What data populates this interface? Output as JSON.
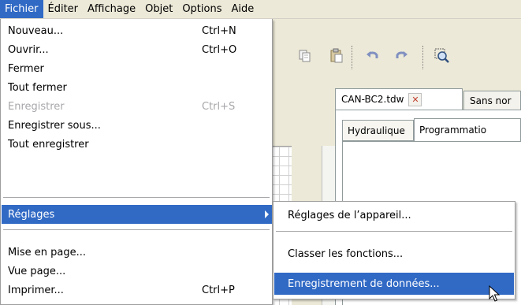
{
  "menubar": {
    "items": [
      {
        "label": "Fichier",
        "active": true
      },
      {
        "label": "Éditer"
      },
      {
        "label": "Affichage"
      },
      {
        "label": "Objet"
      },
      {
        "label": "Options"
      },
      {
        "label": "Aide"
      }
    ]
  },
  "file_menu": {
    "items": [
      {
        "label": "Nouveau...",
        "shortcut": "Ctrl+N"
      },
      {
        "label": "Ouvrir...",
        "shortcut": "Ctrl+O"
      },
      {
        "label": "Fermer",
        "shortcut": ""
      },
      {
        "label": "Tout fermer",
        "shortcut": ""
      },
      {
        "label": "Enregistrer",
        "shortcut": "Ctrl+S",
        "disabled": true
      },
      {
        "label": "Enregistrer sous...",
        "shortcut": ""
      },
      {
        "label": "Tout enregistrer",
        "shortcut": ""
      },
      {
        "label": "Réglages",
        "shortcut": "",
        "submenu": true,
        "highlighted": true
      },
      {
        "label": "Mise en page...",
        "shortcut": ""
      },
      {
        "label": "Vue page...",
        "shortcut": ""
      },
      {
        "label": "Imprimer...",
        "shortcut": "Ctrl+P"
      }
    ]
  },
  "settings_submenu": {
    "items": [
      {
        "label": "Réglages de l’appareil..."
      },
      {
        "label": "Classer les fonctions..."
      },
      {
        "label": "Enregistrement de données...",
        "highlighted": true
      }
    ]
  },
  "document_tabs": [
    {
      "label": "CAN-BC2.tdw",
      "close_icon": "close-icon"
    },
    {
      "label": "Sans nor"
    }
  ],
  "sub_tabs": [
    {
      "label": "Hydraulique"
    },
    {
      "label": "Programmatio"
    }
  ],
  "colors": {
    "highlight": "#316ac5",
    "menubar_bg": "#ece9d8",
    "disabled_text": "#a7a6aa"
  },
  "toolbar_icons": [
    "copy-icon",
    "paste-icon",
    "undo-icon",
    "redo-icon",
    "zoom-icon"
  ]
}
